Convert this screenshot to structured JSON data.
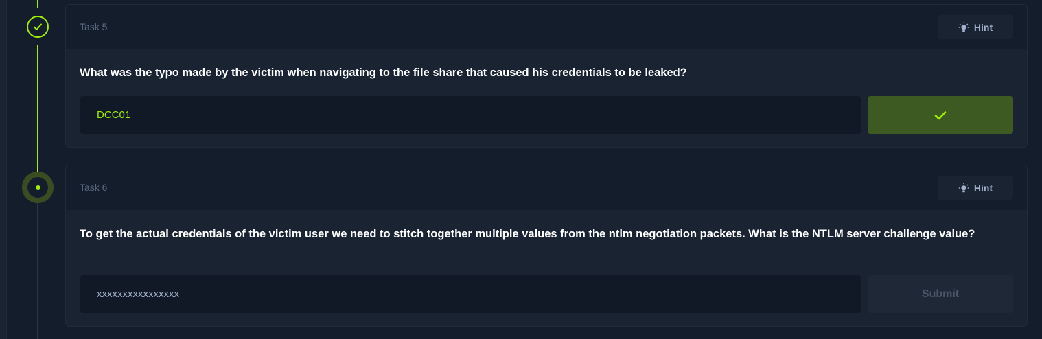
{
  "colors": {
    "accent": "#9fef00",
    "background": "#141d2b",
    "card": "#1a2332",
    "input": "#111927",
    "completed_button": "#3d5a23"
  },
  "tasks": [
    {
      "title": "Task 5",
      "status": "completed",
      "status_icon": "check-icon",
      "hint_label": "Hint",
      "hint_icon": "lightbulb-icon",
      "question": "What was the typo made by the victim when navigating to the file share that caused his credentials to be leaked?",
      "answer_value": "DCC01",
      "submit_icon": "check-icon"
    },
    {
      "title": "Task 6",
      "status": "current",
      "status_icon": "dot-icon",
      "hint_label": "Hint",
      "hint_icon": "lightbulb-icon",
      "question": "To get the actual credentials of the victim user we need to stitch together multiple values from the ntlm negotiation packets. What is the NTLM server challenge value?",
      "answer_placeholder": "xxxxxxxxxxxxxxxx",
      "submit_label": "Submit"
    }
  ]
}
